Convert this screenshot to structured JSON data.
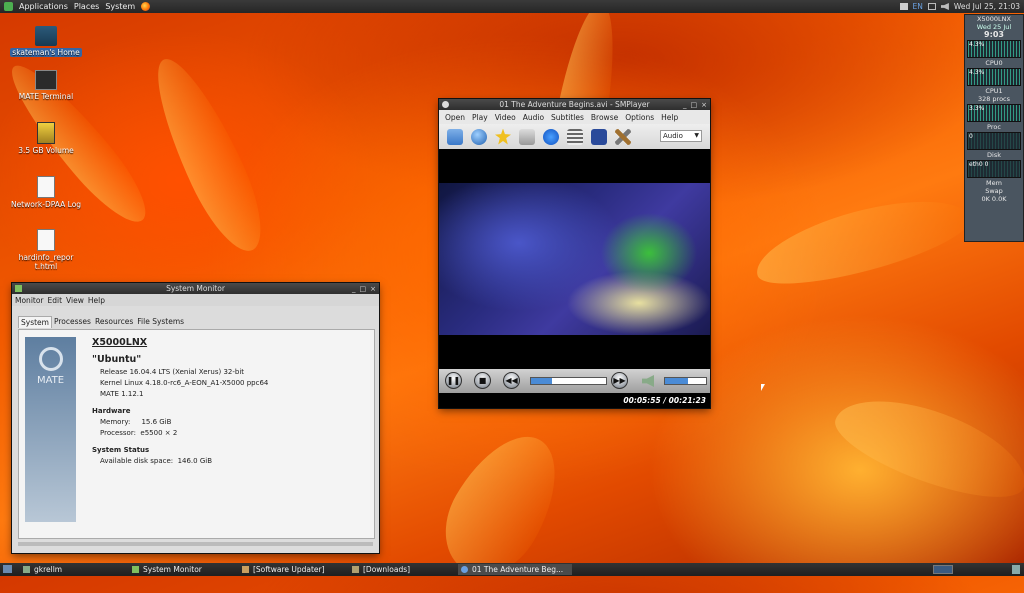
{
  "top_panel": {
    "menus": [
      "Applications",
      "Places",
      "System"
    ],
    "tray_lang": "EN",
    "clock": "Wed Jul 25, 21:03"
  },
  "desktop_icons": [
    {
      "label": "skateman's Home",
      "icon": "folder-home-icon"
    },
    {
      "label": "MATE Terminal",
      "icon": "terminal-icon"
    },
    {
      "label": "3.5 GB Volume",
      "icon": "drive-icon"
    },
    {
      "label": "Network-DPAA Log",
      "icon": "text-file-icon"
    },
    {
      "label": "hardinfo_report.html",
      "icon": "html-file-icon"
    }
  ],
  "system_monitor": {
    "title": "System Monitor",
    "menus": [
      "Monitor",
      "Edit",
      "View",
      "Help"
    ],
    "tabs": [
      "System",
      "Processes",
      "Resources",
      "File Systems"
    ],
    "logo_text": "MATE",
    "hostname": "X5000LNX",
    "distro": "\"Ubuntu\"",
    "release": "Release 16.04.4 LTS (Xenial Xerus) 32-bit",
    "kernel": "Kernel Linux 4.18.0-rc6_A-EON_A1-X5000 ppc64",
    "mate": "MATE 1.12.1",
    "hardware_heading": "Hardware",
    "memory": "Memory:     15.6 GiB",
    "processor": "Processor:  e5500 × 2",
    "status_heading": "System Status",
    "disk": "Available disk space:  146.0 GiB"
  },
  "smplayer": {
    "title": "01 The Adventure Begins.avi - SMPlayer",
    "menus": [
      "Open",
      "Play",
      "Video",
      "Audio",
      "Subtitles",
      "Browse",
      "Options",
      "Help"
    ],
    "audio_select": "Audio",
    "seek_progress": 0.28,
    "volume_level": 0.55,
    "time": "00:05:55 / 00:21:23"
  },
  "gkrellm": {
    "hostname": "X5000LNX",
    "uptime": "Wed 25 Jul",
    "time": "9:03",
    "cpu_top": "4.3%",
    "cpu_label": "CPU0",
    "cpu2": "4.3%",
    "cpu2_label": "CPU1",
    "procs": "328 procs",
    "proc_val": "3.3%",
    "temp_label": "Proc",
    "disk_val": "0",
    "disk_label": "Disk",
    "net_val": "eth0 0",
    "mem_label": "Mem",
    "swap_label": "Swap",
    "swap_val": "0K 0.0K"
  },
  "taskbar": [
    {
      "label": "gkrellm",
      "icon": "gkrellm-icon",
      "active": false
    },
    {
      "label": "System Monitor",
      "icon": "system-monitor-icon",
      "active": false
    },
    {
      "label": "[Software Updater]",
      "icon": "updater-icon",
      "active": false
    },
    {
      "label": "[Downloads]",
      "icon": "folder-icon",
      "active": false
    },
    {
      "label": "01 The Adventure Beg...",
      "icon": "smplayer-icon",
      "active": true
    }
  ]
}
